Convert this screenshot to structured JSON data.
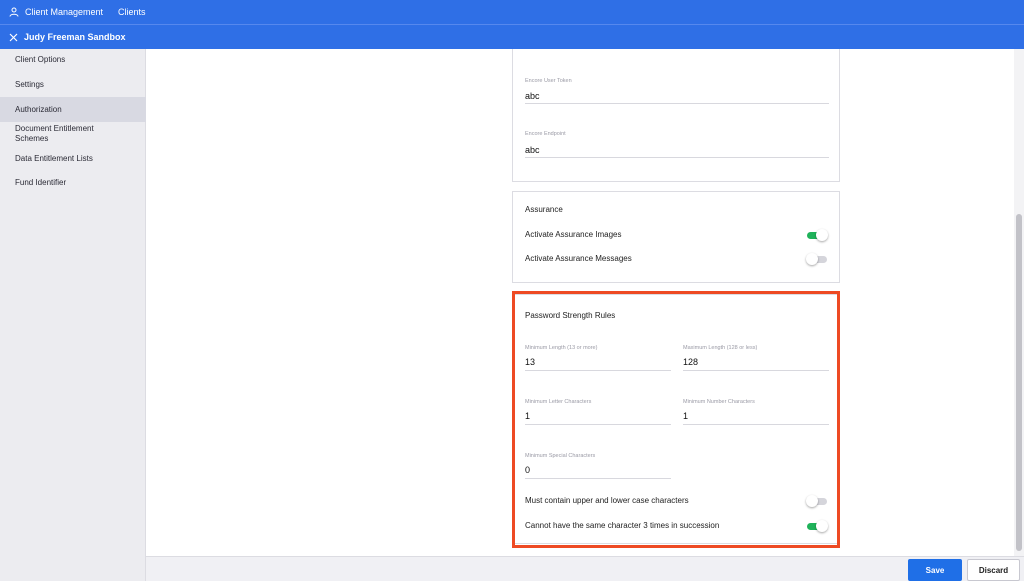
{
  "topbar": {
    "nav_item_1": "Client Management",
    "nav_item_2": "Clients"
  },
  "subbar": {
    "title": "Judy Freeman Sandbox"
  },
  "sidebar": {
    "items": [
      {
        "label": "Client Options"
      },
      {
        "label": "Settings"
      },
      {
        "label": "Authorization"
      },
      {
        "label": "Document Entitlement Schemes"
      },
      {
        "label": "Data Entitlement Lists"
      },
      {
        "label": "Fund Identifier"
      }
    ]
  },
  "encore": {
    "user_token_label": "Encore User Token",
    "user_token_value": "abc",
    "endpoint_label": "Encore Endpoint",
    "endpoint_value": "abc"
  },
  "assurance": {
    "title": "Assurance",
    "images_label": "Activate Assurance Images",
    "images_on": true,
    "messages_label": "Activate Assurance Messages",
    "messages_on": false
  },
  "password": {
    "title": "Password Strength Rules",
    "min_length_label": "Minimum Length (13 or more)",
    "min_length_value": "13",
    "max_length_label": "Maximum Length (128 or less)",
    "max_length_value": "128",
    "min_letter_label": "Minimum Letter Characters",
    "min_letter_value": "1",
    "min_number_label": "Minimum Number Characters",
    "min_number_value": "1",
    "min_special_label": "Minimum Special Characters",
    "min_special_value": "0",
    "upper_lower_label": "Must contain upper and lower case characters",
    "upper_lower_on": false,
    "no_repeat_label": "Cannot have the same character 3 times in succession",
    "no_repeat_on": true
  },
  "footer": {
    "save_label": "Save",
    "discard_label": "Discard"
  },
  "colors": {
    "brand": "#2f6fe6",
    "toggle_on": "#1fb25a",
    "highlight": "#ee4a23",
    "save_button": "#1f6fe7"
  }
}
